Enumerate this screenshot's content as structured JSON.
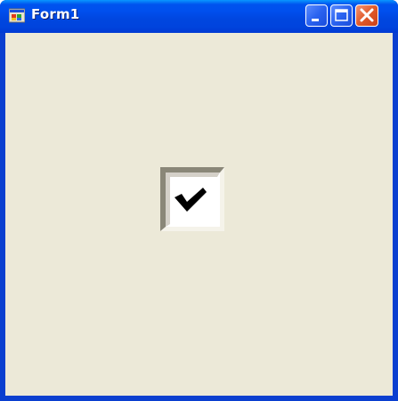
{
  "window": {
    "title": "Form1",
    "icon": "windows-forms-app-icon",
    "caption_buttons": {
      "minimize_icon": "minimize-icon",
      "maximize_icon": "maximize-icon",
      "close_icon": "close-icon"
    }
  },
  "client": {
    "background": "#ece9d8",
    "checkbox": {
      "checked": true,
      "label": "",
      "icon": "checkmark-icon"
    }
  },
  "colors": {
    "titlebar": "#0053ee",
    "frame": "#0a3fd0",
    "close_button": "#e15a2a"
  }
}
